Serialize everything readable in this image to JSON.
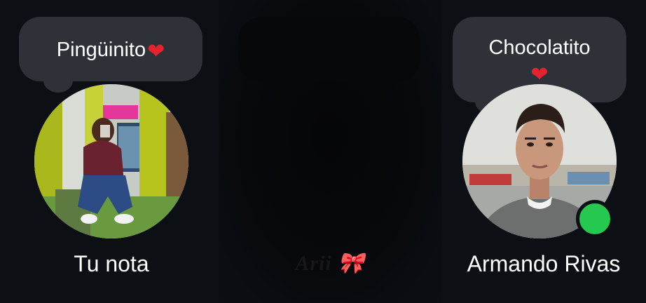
{
  "notes": [
    {
      "owner_label": "Tu nota",
      "note_text": "Pingüinito",
      "emoji": "❤",
      "online": false
    },
    {
      "owner_label": "Arii 🎀"
    },
    {
      "owner_label": "Armando Rivas",
      "note_text": "Chocolatito",
      "emoji": "❤",
      "online": true
    }
  ],
  "colors": {
    "background": "#0c1015",
    "bubble": "#2e3238",
    "online_dot": "#25c950",
    "heart": "#e5232f"
  }
}
